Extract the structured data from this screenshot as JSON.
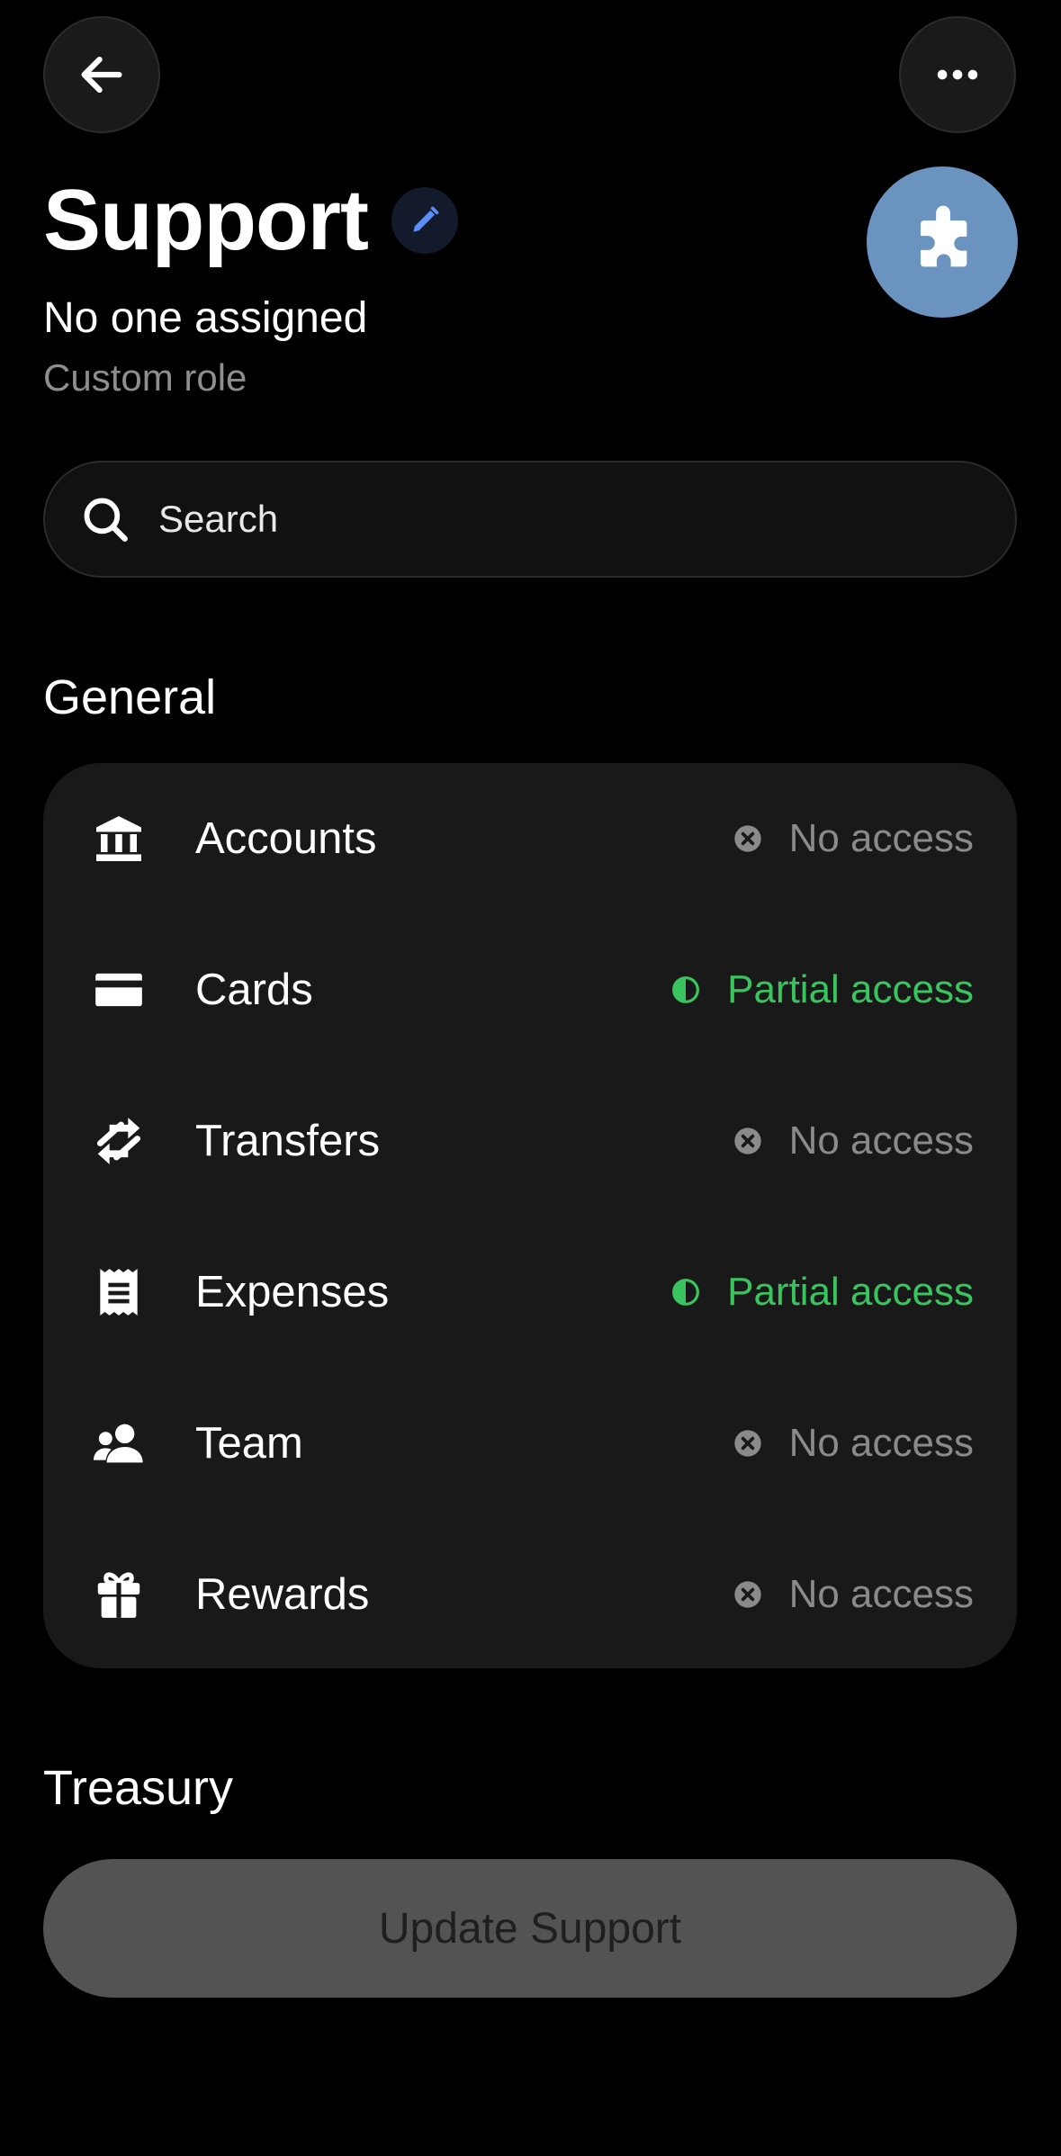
{
  "header": {
    "back_icon": "arrow-left-icon",
    "more_icon": "more-horizontal-icon",
    "title": "Support",
    "edit_icon": "pencil-icon",
    "avatar_icon": "puzzle-icon",
    "avatar_color": "#6a93bf",
    "subtitle": "No one assigned",
    "caption": "Custom role"
  },
  "search": {
    "placeholder": "Search",
    "icon": "search-icon"
  },
  "sections": {
    "general": {
      "title": "General",
      "items": [
        {
          "label": "Accounts",
          "icon": "bank-icon",
          "status": "No access",
          "status_type": "none"
        },
        {
          "label": "Cards",
          "icon": "credit-card-icon",
          "status": "Partial access",
          "status_type": "partial"
        },
        {
          "label": "Transfers",
          "icon": "transfer-arrows-icon",
          "status": "No access",
          "status_type": "none"
        },
        {
          "label": "Expenses",
          "icon": "receipt-icon",
          "status": "Partial access",
          "status_type": "partial"
        },
        {
          "label": "Team",
          "icon": "people-icon",
          "status": "No access",
          "status_type": "none"
        },
        {
          "label": "Rewards",
          "icon": "gift-icon",
          "status": "No access",
          "status_type": "none"
        }
      ]
    },
    "treasury": {
      "title": "Treasury"
    }
  },
  "footer": {
    "update_label": "Update Support"
  },
  "colors": {
    "background": "#000000",
    "card": "#191919",
    "partial": "#3ac45e",
    "none": "#8a8a8a",
    "button": "#535353"
  }
}
